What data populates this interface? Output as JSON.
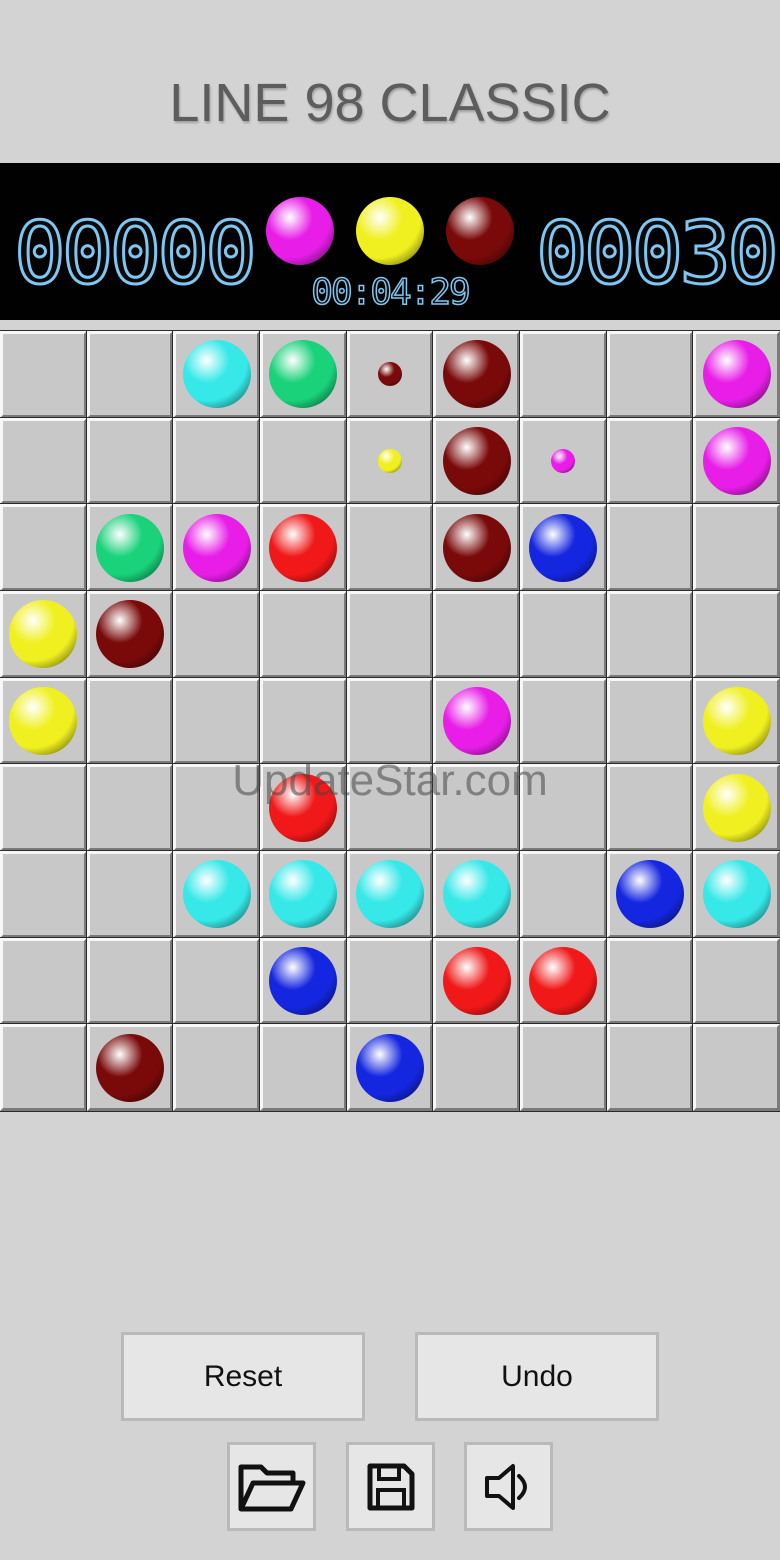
{
  "title": "LINE 98 CLASSIC",
  "score_left": "00000",
  "score_right": "00030",
  "timer": "00:04:29",
  "colors": {
    "magenta": "#e81ee8",
    "yellow": "#f0f020",
    "darkred": "#7a0a0a",
    "cyan": "#36e8e8",
    "green": "#19d27a",
    "red": "#f01818",
    "blue": "#1426e0"
  },
  "next_balls": [
    "magenta",
    "yellow",
    "darkred"
  ],
  "board": [
    [
      "",
      "",
      "cyan",
      "green",
      "darkred:small",
      "darkred",
      "",
      "",
      "magenta"
    ],
    [
      "",
      "",
      "",
      "",
      "yellow:small",
      "darkred",
      "magenta:small",
      "",
      "magenta"
    ],
    [
      "",
      "green",
      "magenta",
      "red",
      "",
      "darkred",
      "blue",
      "",
      ""
    ],
    [
      "yellow",
      "darkred",
      "",
      "",
      "",
      "",
      "",
      "",
      ""
    ],
    [
      "yellow",
      "",
      "",
      "",
      "",
      "magenta",
      "",
      "",
      "yellow"
    ],
    [
      "",
      "",
      "",
      "red",
      "",
      "",
      "",
      "",
      "yellow"
    ],
    [
      "",
      "",
      "cyan",
      "cyan",
      "cyan",
      "cyan",
      "",
      "blue",
      "cyan"
    ],
    [
      "",
      "",
      "",
      "blue",
      "",
      "red",
      "red",
      "",
      ""
    ],
    [
      "",
      "darkred",
      "",
      "",
      "blue",
      "",
      "",
      "",
      ""
    ]
  ],
  "watermark": "UpdateStar.com",
  "buttons": {
    "reset": "Reset",
    "undo": "Undo"
  },
  "icons": {
    "open": "folder-open-icon",
    "save": "floppy-disk-icon",
    "sound": "speaker-icon"
  }
}
